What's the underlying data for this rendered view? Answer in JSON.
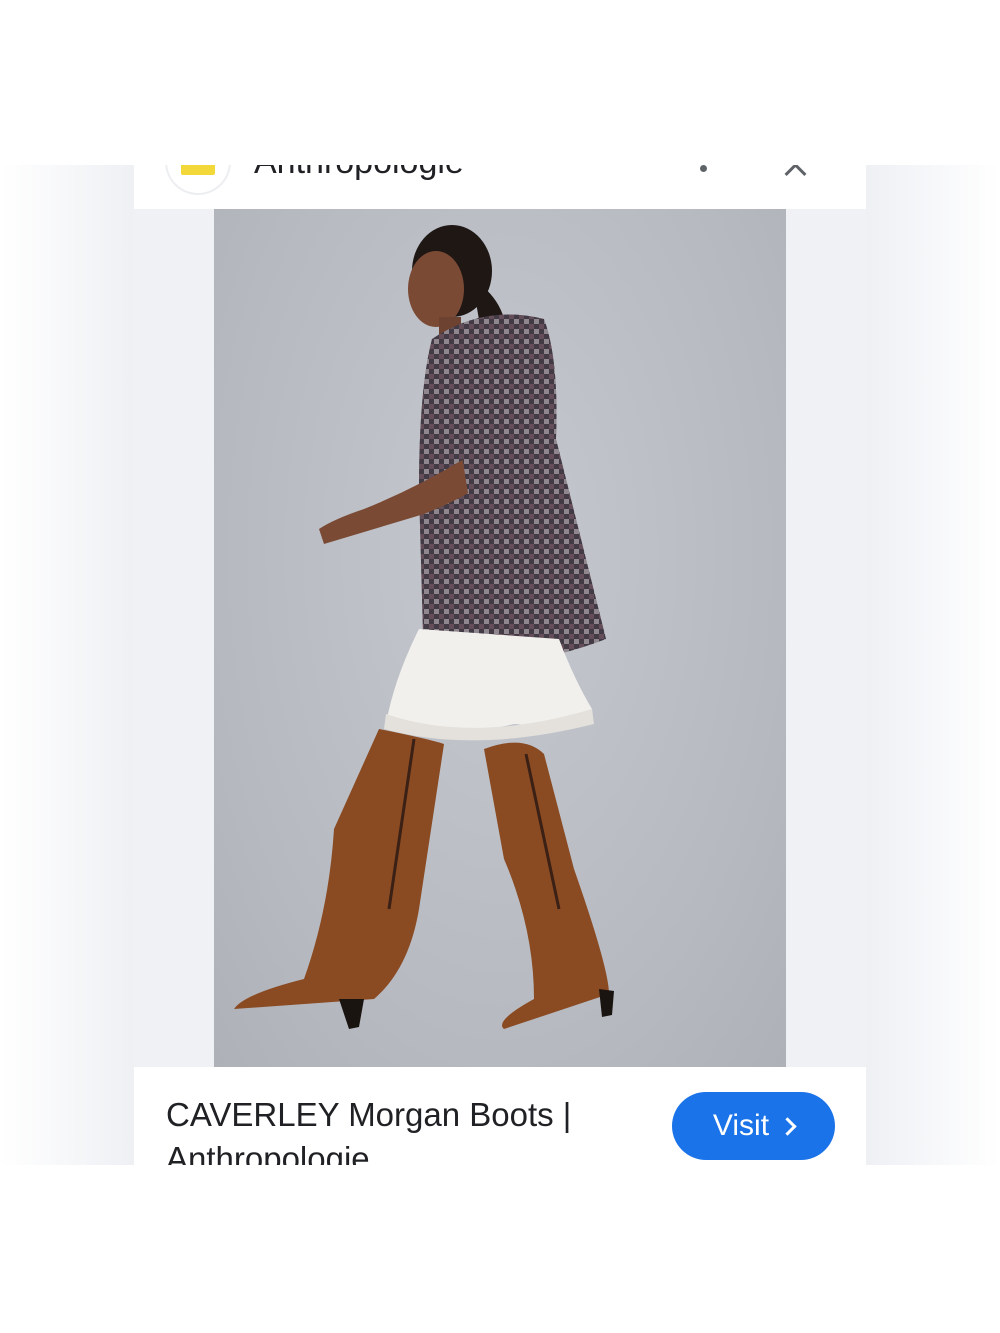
{
  "header": {
    "site_name": "Anthropologie",
    "logo_icon": "site-favicon-icon",
    "more_icon": "more-options-icon",
    "close_icon": "close-icon",
    "logo_color": "#f3d83a"
  },
  "image": {
    "description_icon": "product-photo"
  },
  "result": {
    "title_line_1": "CAVERLEY Morgan Boots |",
    "title_line_2": "Anthropologie",
    "visit_label": "Visit",
    "visit_icon": "chevron-right-icon",
    "accent_color": "#1a73e8"
  }
}
